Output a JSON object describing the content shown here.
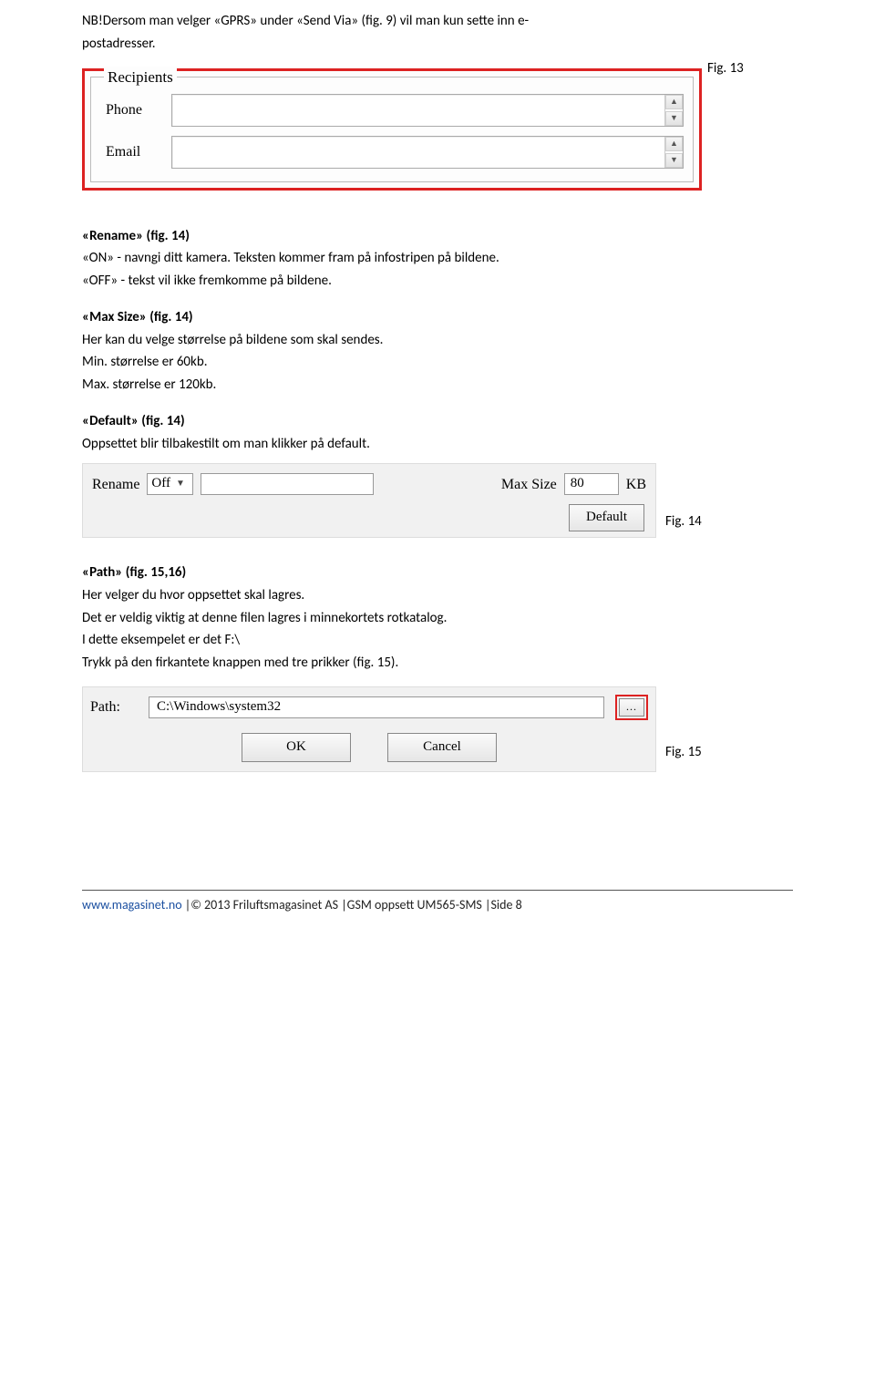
{
  "intro": {
    "l1a": "NB!Dersom man velger «GPRS» under «Send Via» (fig. 9) vil man kun sette inn e-",
    "l1b": "postadresser."
  },
  "fig13": {
    "legend": "Recipients",
    "phone": "Phone",
    "email": "Email",
    "caption": "Fig. 13"
  },
  "rename": {
    "title": "«Rename» (fig. 14)",
    "l1": "«ON» - navngi ditt kamera. Teksten kommer fram på infostripen på bildene.",
    "l2": "«OFF» - tekst vil ikke fremkomme på bildene."
  },
  "maxsize": {
    "title": "«Max Size» (fig. 14)",
    "l1": "Her kan du velge størrelse på bildene som skal sendes.",
    "l2": "Min. størrelse er 60kb.",
    "l3": "Max. størrelse er 120kb."
  },
  "defaultsec": {
    "title": "«Default» (fig. 14)",
    "l1": "Oppsettet blir tilbakestilt om man klikker på default."
  },
  "fig14": {
    "rename_label": "Rename",
    "rename_value": "Off",
    "maxsize_label": "Max Size",
    "maxsize_value": "80",
    "kb": "KB",
    "default_btn": "Default",
    "caption": "Fig. 14"
  },
  "pathsec": {
    "title": "«Path» (fig. 15,16)",
    "l1": "Her velger du hvor oppsettet skal lagres.",
    "l2": "Det er veldig viktig at denne filen lagres i minnekortets rotkatalog.",
    "l3": "I dette eksempelet er det F:\\",
    "l4": "Trykk på den firkantete knappen med tre prikker (fig. 15)."
  },
  "fig15": {
    "path_label": "Path:",
    "path_value": "C:\\Windows\\system32",
    "browse": "...",
    "ok": "OK",
    "cancel": "Cancel",
    "caption": "Fig. 15"
  },
  "footer": {
    "link": "www.magasinet.no",
    "rest": " |© 2013 Friluftsmagasinet AS |GSM oppsett UM565-SMS |Side 8"
  }
}
